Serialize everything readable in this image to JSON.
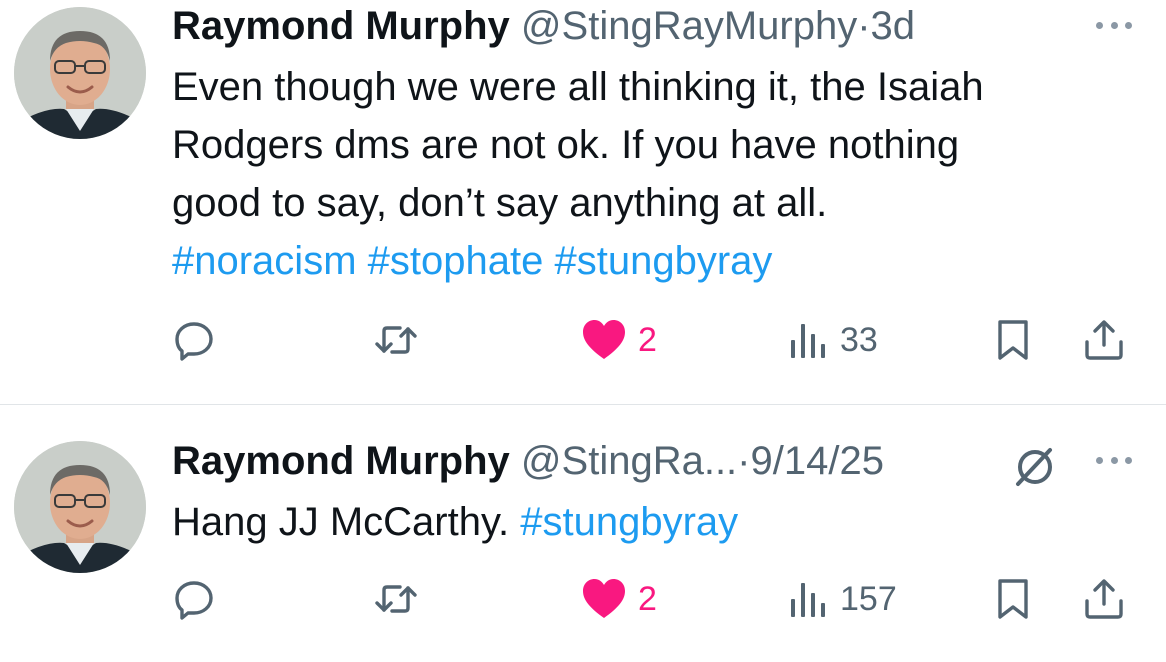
{
  "tweets": [
    {
      "author_name": "Raymond Murphy",
      "handle": "@StingRayMurphy",
      "separator": "·",
      "time": "3d",
      "text_lines": [
        "Even though we were all thinking it, the Isaiah",
        "Rodgers dms are not ok. If you have nothing",
        "good to say, don’t say anything at all."
      ],
      "hashtags": [
        "#noracism",
        "#stophate",
        "#stungbyray"
      ],
      "like_count": "2",
      "view_count": "33"
    },
    {
      "author_name": "Raymond Murphy",
      "handle": "@StingRa...",
      "separator": "·",
      "time": "9/14/25",
      "text": "Hang JJ McCarthy.",
      "hashtags": [
        "#stungbyray"
      ],
      "like_count": "2",
      "view_count": "157"
    }
  ],
  "icons": {
    "reply": "reply-icon",
    "retweet": "retweet-icon",
    "like": "heart-icon",
    "views": "views-icon",
    "bookmark": "bookmark-icon",
    "share": "share-icon",
    "more": "more-icon",
    "grok": "grok-icon"
  },
  "colors": {
    "text": "#0f1419",
    "secondary": "#536471",
    "hashtag": "#1d9bf0",
    "like": "#f91880",
    "divider": "#e1e5e8"
  }
}
